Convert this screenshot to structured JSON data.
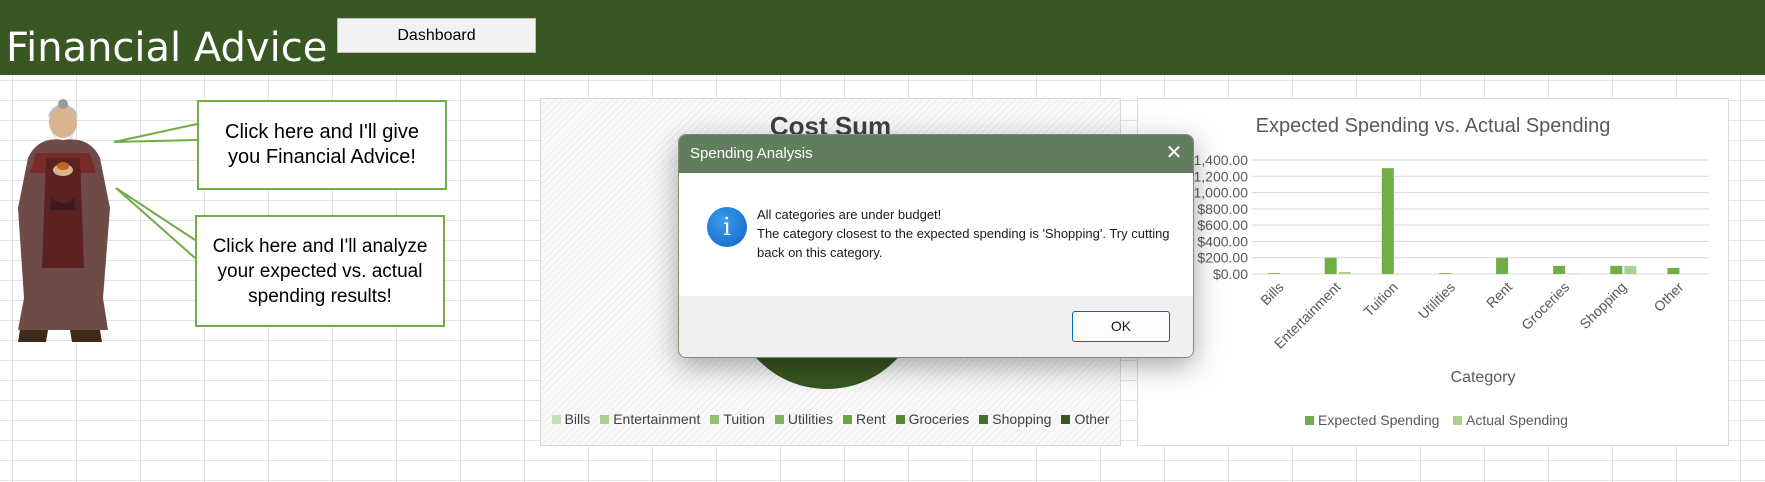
{
  "banner": {
    "title": "Financial Advice",
    "dashboard_label": "Dashboard",
    "color": "#385723"
  },
  "callouts": {
    "advice": "Click here and I'll give you Financial Advice!",
    "analyze": "Click here and I'll analyze your expected vs. actual spending results!"
  },
  "pie_chart": {
    "title": "Cost Sum",
    "legend": [
      {
        "label": "Bills",
        "color": "#c5dcb6"
      },
      {
        "label": "Entertainment",
        "color": "#a9d08e"
      },
      {
        "label": "Tuition",
        "color": "#93c073"
      },
      {
        "label": "Utilities",
        "color": "#7eb35b"
      },
      {
        "label": "Rent",
        "color": "#6aa443"
      },
      {
        "label": "Groceries",
        "color": "#558a34"
      },
      {
        "label": "Shopping",
        "color": "#466f2b"
      },
      {
        "label": "Other",
        "color": "#385723"
      }
    ]
  },
  "chart_data": {
    "type": "bar",
    "title": "Expected Spending vs. Actual Spending",
    "xlabel": "Category",
    "ylabel": "",
    "categories": [
      "Bills",
      "Entertainment",
      "Tuition",
      "Utilities",
      "Rent",
      "Groceries",
      "Shopping",
      "Other"
    ],
    "series": [
      {
        "name": "Expected Spending",
        "color": "#70ad47",
        "values": [
          10,
          200,
          1300,
          10,
          200,
          100,
          100,
          75
        ]
      },
      {
        "name": "Actual Spending",
        "color": "#a9d08e",
        "values": [
          0,
          25,
          0,
          0,
          0,
          5,
          100,
          0
        ]
      }
    ],
    "y_tick_labels": [
      "$0.00",
      "$200.00",
      "$400.00",
      "$600.00",
      "$800.00",
      "$1,000.00",
      "$1,200.00",
      "$1,400.00"
    ],
    "ylim": [
      0,
      1400
    ],
    "grid": true,
    "legend": "bottom"
  },
  "dialog": {
    "title": "Spending Analysis",
    "close_glyph": "✕",
    "icon_glyph": "i",
    "line1": "All categories are under budget!",
    "line2": "The category closest to the expected spending is 'Shopping'. Try cutting back on this category.",
    "ok_label": "OK"
  }
}
